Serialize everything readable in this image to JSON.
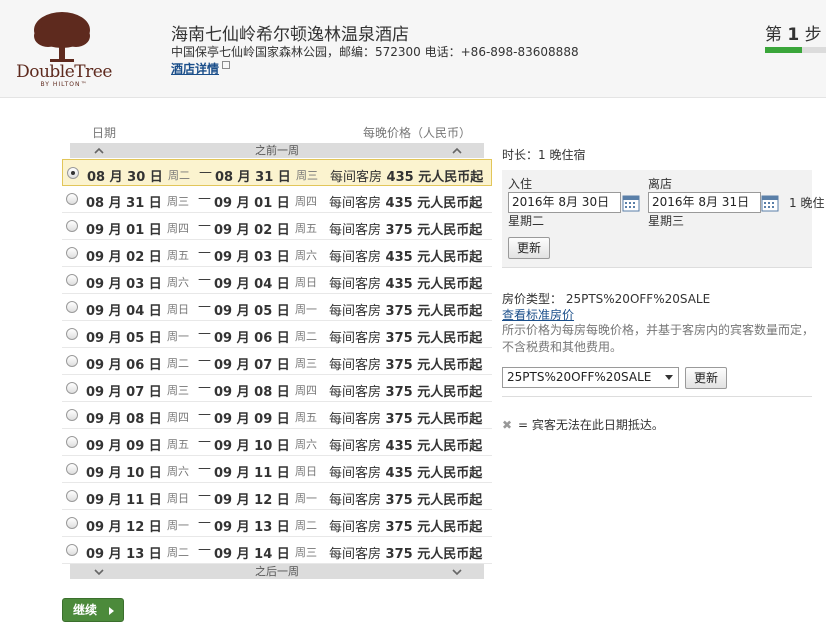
{
  "header": {
    "logo_word": "DoubleTree",
    "logo_sub": "BY HILTON™",
    "hotel_name": "海南七仙岭希尔顿逸林温泉酒店",
    "address": "中国保亭七仙岭国家森林公园，邮编：572300   电话：+86-898-83608888",
    "details_link": "酒店详情",
    "step_prefix": "第",
    "step_number": "1",
    "step_suffix": "步",
    "step_progress": 0.6
  },
  "list": {
    "col_date": "日期",
    "col_price": "每晚价格（人民币）",
    "prev_week": "之前一周",
    "next_week": "之后一周",
    "price_prefix": "每间客房",
    "price_suffix": "元人民币起",
    "rows": [
      {
        "from": "08 月 30 日",
        "from_day": "周二",
        "to": "08 月 31 日",
        "to_day": "周三",
        "price": "435",
        "selected": true
      },
      {
        "from": "08 月 31 日",
        "from_day": "周三",
        "to": "09 月 01 日",
        "to_day": "周四",
        "price": "435",
        "selected": false
      },
      {
        "from": "09 月 01 日",
        "from_day": "周四",
        "to": "09 月 02 日",
        "to_day": "周五",
        "price": "375",
        "selected": false
      },
      {
        "from": "09 月 02 日",
        "from_day": "周五",
        "to": "09 月 03 日",
        "to_day": "周六",
        "price": "435",
        "selected": false
      },
      {
        "from": "09 月 03 日",
        "from_day": "周六",
        "to": "09 月 04 日",
        "to_day": "周日",
        "price": "435",
        "selected": false
      },
      {
        "from": "09 月 04 日",
        "from_day": "周日",
        "to": "09 月 05 日",
        "to_day": "周一",
        "price": "375",
        "selected": false
      },
      {
        "from": "09 月 05 日",
        "from_day": "周一",
        "to": "09 月 06 日",
        "to_day": "周二",
        "price": "375",
        "selected": false
      },
      {
        "from": "09 月 06 日",
        "from_day": "周二",
        "to": "09 月 07 日",
        "to_day": "周三",
        "price": "375",
        "selected": false
      },
      {
        "from": "09 月 07 日",
        "from_day": "周三",
        "to": "09 月 08 日",
        "to_day": "周四",
        "price": "375",
        "selected": false
      },
      {
        "from": "09 月 08 日",
        "from_day": "周四",
        "to": "09 月 09 日",
        "to_day": "周五",
        "price": "375",
        "selected": false
      },
      {
        "from": "09 月 09 日",
        "from_day": "周五",
        "to": "09 月 10 日",
        "to_day": "周六",
        "price": "435",
        "selected": false
      },
      {
        "from": "09 月 10 日",
        "from_day": "周六",
        "to": "09 月 11 日",
        "to_day": "周日",
        "price": "435",
        "selected": false
      },
      {
        "from": "09 月 11 日",
        "from_day": "周日",
        "to": "09 月 12 日",
        "to_day": "周一",
        "price": "375",
        "selected": false
      },
      {
        "from": "09 月 12 日",
        "from_day": "周一",
        "to": "09 月 13 日",
        "to_day": "周二",
        "price": "375",
        "selected": false
      },
      {
        "from": "09 月 13 日",
        "from_day": "周二",
        "to": "09 月 14 日",
        "to_day": "周三",
        "price": "375",
        "selected": false
      }
    ],
    "continue_label": "继续"
  },
  "panel": {
    "duration": "时长：1 晚住宿",
    "checkin_label": "入住",
    "checkin_value": "2016年 8月 30日",
    "checkin_weekday": "星期二",
    "checkout_label": "离店",
    "checkout_value": "2016年 8月 31日",
    "checkout_weekday": "星期三",
    "nights": "1 晚住",
    "update_label": "更新",
    "rate_type": "房价类型：  25PTS%20OFF%20SALE",
    "standard_rate_link": "查看标准房价",
    "rate_note": "所示价格为每房每晚价格，并基于客房内的宾客数量而定，不含税费和其他费用。",
    "rate_select_value": "25PTS%20OFF%20SALE",
    "rate_update_label": "更新",
    "legend_text": "= 宾客无法在此日期抵达。"
  },
  "colors": {
    "selected_row_bg": "#fbf3cf",
    "brand": "#5e2a1e",
    "continue_bg": "#4c8a3b",
    "progress": "#3aa63a",
    "link": "#1a4e8a"
  }
}
